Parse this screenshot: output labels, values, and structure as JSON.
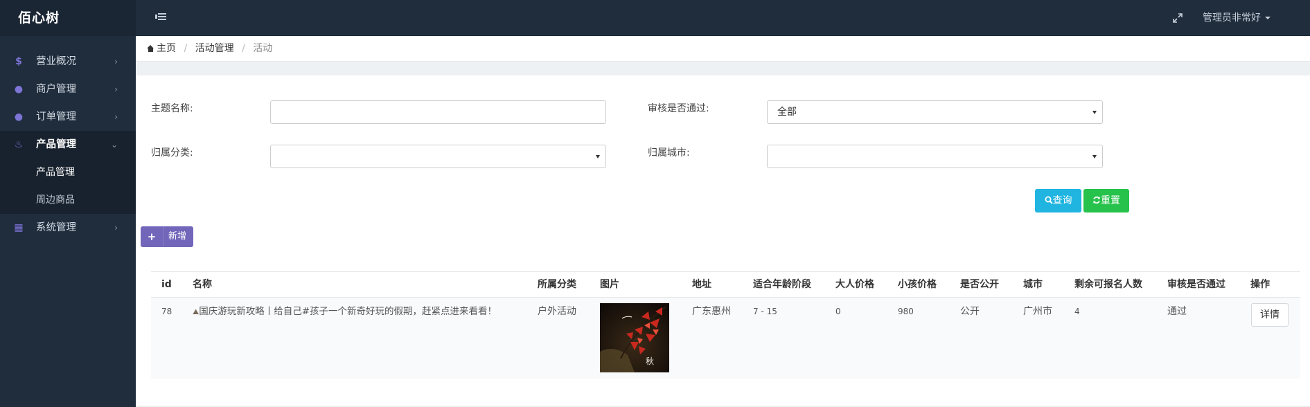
{
  "header": {
    "brand": "佰心树",
    "user": "管理员非常好"
  },
  "sidebar": {
    "items": [
      {
        "icon": "$",
        "icon_name": "dollar-icon",
        "label": "营业概况"
      },
      {
        "icon": "●",
        "icon_name": "globe-icon",
        "label": "商户管理"
      },
      {
        "icon": "●",
        "icon_name": "tint-icon",
        "label": "订单管理"
      },
      {
        "icon": "♨",
        "icon_name": "fire-icon",
        "label": "产品管理"
      },
      {
        "icon": "▦",
        "icon_name": "th-icon",
        "label": "系统管理"
      }
    ],
    "sub_items": [
      "产品管理",
      "周边商品"
    ]
  },
  "breadcrumb": {
    "home": "主页",
    "level1": "活动管理",
    "level2": "活动"
  },
  "filters": {
    "theme_label": "主题名称:",
    "theme_value": "",
    "approved_label": "审核是否通过:",
    "approved_value": "全部",
    "category_label": "归属分类:",
    "category_value": "",
    "city_label": "归属城市:",
    "city_value": ""
  },
  "buttons": {
    "query": "查询",
    "reset": "重置",
    "add": "新增",
    "detail": "详情"
  },
  "table": {
    "columns": [
      "id",
      "名称",
      "所属分类",
      "图片",
      "地址",
      "适合年龄阶段",
      "大人价格",
      "小孩价格",
      "是否公开",
      "城市",
      "剩余可报名人数",
      "审核是否通过",
      "操作"
    ],
    "rows": [
      {
        "id": "78",
        "name": "国庆游玩新攻略丨给自己#孩子一个新奇好玩的假期，赶紧点进来看看！",
        "category": "户外活动",
        "image_caption": "秋",
        "address": "广东惠州",
        "age": "7 - 15",
        "adult_price": "0",
        "child_price": "980",
        "public": "公开",
        "city": "广州市",
        "remaining": "4",
        "approved": "通过"
      }
    ]
  },
  "colors": {
    "topbar": "#1f2d3d",
    "accent_purple": "#7266ba",
    "query_blue": "#1fb5e0",
    "reset_green": "#27c24c"
  }
}
